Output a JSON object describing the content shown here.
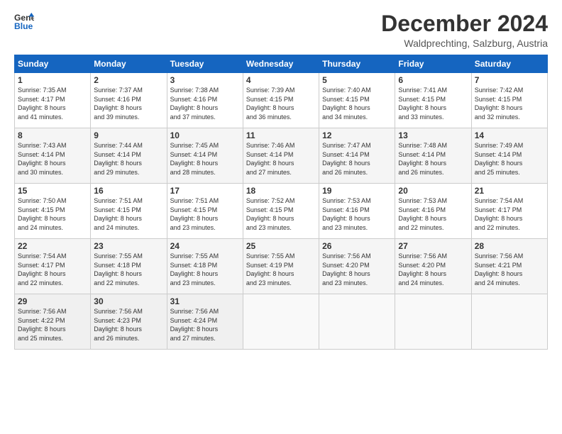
{
  "logo": {
    "line1": "General",
    "line2": "Blue"
  },
  "title": "December 2024",
  "subtitle": "Waldprechting, Salzburg, Austria",
  "headers": [
    "Sunday",
    "Monday",
    "Tuesday",
    "Wednesday",
    "Thursday",
    "Friday",
    "Saturday"
  ],
  "weeks": [
    [
      {
        "day": "1",
        "text": "Sunrise: 7:35 AM\nSunset: 4:17 PM\nDaylight: 8 hours\nand 41 minutes."
      },
      {
        "day": "2",
        "text": "Sunrise: 7:37 AM\nSunset: 4:16 PM\nDaylight: 8 hours\nand 39 minutes."
      },
      {
        "day": "3",
        "text": "Sunrise: 7:38 AM\nSunset: 4:16 PM\nDaylight: 8 hours\nand 37 minutes."
      },
      {
        "day": "4",
        "text": "Sunrise: 7:39 AM\nSunset: 4:15 PM\nDaylight: 8 hours\nand 36 minutes."
      },
      {
        "day": "5",
        "text": "Sunrise: 7:40 AM\nSunset: 4:15 PM\nDaylight: 8 hours\nand 34 minutes."
      },
      {
        "day": "6",
        "text": "Sunrise: 7:41 AM\nSunset: 4:15 PM\nDaylight: 8 hours\nand 33 minutes."
      },
      {
        "day": "7",
        "text": "Sunrise: 7:42 AM\nSunset: 4:15 PM\nDaylight: 8 hours\nand 32 minutes."
      }
    ],
    [
      {
        "day": "8",
        "text": "Sunrise: 7:43 AM\nSunset: 4:14 PM\nDaylight: 8 hours\nand 30 minutes."
      },
      {
        "day": "9",
        "text": "Sunrise: 7:44 AM\nSunset: 4:14 PM\nDaylight: 8 hours\nand 29 minutes."
      },
      {
        "day": "10",
        "text": "Sunrise: 7:45 AM\nSunset: 4:14 PM\nDaylight: 8 hours\nand 28 minutes."
      },
      {
        "day": "11",
        "text": "Sunrise: 7:46 AM\nSunset: 4:14 PM\nDaylight: 8 hours\nand 27 minutes."
      },
      {
        "day": "12",
        "text": "Sunrise: 7:47 AM\nSunset: 4:14 PM\nDaylight: 8 hours\nand 26 minutes."
      },
      {
        "day": "13",
        "text": "Sunrise: 7:48 AM\nSunset: 4:14 PM\nDaylight: 8 hours\nand 26 minutes."
      },
      {
        "day": "14",
        "text": "Sunrise: 7:49 AM\nSunset: 4:14 PM\nDaylight: 8 hours\nand 25 minutes."
      }
    ],
    [
      {
        "day": "15",
        "text": "Sunrise: 7:50 AM\nSunset: 4:15 PM\nDaylight: 8 hours\nand 24 minutes."
      },
      {
        "day": "16",
        "text": "Sunrise: 7:51 AM\nSunset: 4:15 PM\nDaylight: 8 hours\nand 24 minutes."
      },
      {
        "day": "17",
        "text": "Sunrise: 7:51 AM\nSunset: 4:15 PM\nDaylight: 8 hours\nand 23 minutes."
      },
      {
        "day": "18",
        "text": "Sunrise: 7:52 AM\nSunset: 4:15 PM\nDaylight: 8 hours\nand 23 minutes."
      },
      {
        "day": "19",
        "text": "Sunrise: 7:53 AM\nSunset: 4:16 PM\nDaylight: 8 hours\nand 23 minutes."
      },
      {
        "day": "20",
        "text": "Sunrise: 7:53 AM\nSunset: 4:16 PM\nDaylight: 8 hours\nand 22 minutes."
      },
      {
        "day": "21",
        "text": "Sunrise: 7:54 AM\nSunset: 4:17 PM\nDaylight: 8 hours\nand 22 minutes."
      }
    ],
    [
      {
        "day": "22",
        "text": "Sunrise: 7:54 AM\nSunset: 4:17 PM\nDaylight: 8 hours\nand 22 minutes."
      },
      {
        "day": "23",
        "text": "Sunrise: 7:55 AM\nSunset: 4:18 PM\nDaylight: 8 hours\nand 22 minutes."
      },
      {
        "day": "24",
        "text": "Sunrise: 7:55 AM\nSunset: 4:18 PM\nDaylight: 8 hours\nand 23 minutes."
      },
      {
        "day": "25",
        "text": "Sunrise: 7:55 AM\nSunset: 4:19 PM\nDaylight: 8 hours\nand 23 minutes."
      },
      {
        "day": "26",
        "text": "Sunrise: 7:56 AM\nSunset: 4:20 PM\nDaylight: 8 hours\nand 23 minutes."
      },
      {
        "day": "27",
        "text": "Sunrise: 7:56 AM\nSunset: 4:20 PM\nDaylight: 8 hours\nand 24 minutes."
      },
      {
        "day": "28",
        "text": "Sunrise: 7:56 AM\nSunset: 4:21 PM\nDaylight: 8 hours\nand 24 minutes."
      }
    ],
    [
      {
        "day": "29",
        "text": "Sunrise: 7:56 AM\nSunset: 4:22 PM\nDaylight: 8 hours\nand 25 minutes."
      },
      {
        "day": "30",
        "text": "Sunrise: 7:56 AM\nSunset: 4:23 PM\nDaylight: 8 hours\nand 26 minutes."
      },
      {
        "day": "31",
        "text": "Sunrise: 7:56 AM\nSunset: 4:24 PM\nDaylight: 8 hours\nand 27 minutes."
      },
      {
        "day": "",
        "text": ""
      },
      {
        "day": "",
        "text": ""
      },
      {
        "day": "",
        "text": ""
      },
      {
        "day": "",
        "text": ""
      }
    ]
  ]
}
